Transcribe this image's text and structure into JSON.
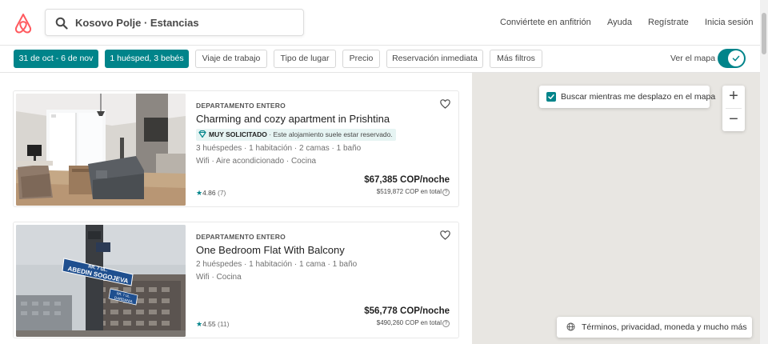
{
  "header": {
    "search_text": "Kosovo Polje · Estancias",
    "nav": {
      "host": "Conviértete en anfitrión",
      "help": "Ayuda",
      "signup": "Regístrate",
      "login": "Inicia sesión"
    }
  },
  "filters": {
    "dates": "31 de oct - 6 de nov",
    "guests": "1 huésped, 3 bebés",
    "work_trip": "Viaje de trabajo",
    "place_type": "Tipo de lugar",
    "price": "Precio",
    "instant_book": "Reservación inmediata",
    "more_filters": "Más filtros",
    "show_map": "Ver el mapa",
    "show_map_on": true
  },
  "listings": [
    {
      "type": "DEPARTAMENTO ENTERO",
      "title": "Charming and cozy apartment in Prishtina",
      "badge_label": "MUY SOLICITADO",
      "badge_text": " · Este alojamiento suele estar reservado.",
      "details": "3 huéspedes · 1 habitación · 2 camas · 1 baño",
      "amenities": "Wifi · Aire acondicionado · Cocina",
      "rating": "4.86",
      "reviews": "(7)",
      "price": "$67,385 COP/noche",
      "total": "$519,872 COP en total",
      "help_glyph": "?"
    },
    {
      "type": "DEPARTAMENTO ENTERO",
      "title": "One Bedroom Flat With Balcony",
      "details": "2 huéspedes · 1 habitación · 1 cama · 1 baño",
      "amenities": "Wifi · Cocina",
      "rating": "4.55",
      "reviews": "(11)",
      "price": "$56,778 COP/noche",
      "total": "$490,260 COP en total",
      "help_glyph": "?",
      "photo_sign_top": "RR. 7 UL.",
      "photo_sign_main": "ABEDIN SOGOJEVA",
      "photo_sign_small_1": "RR. 7 UL.",
      "photo_sign_small_2": "DARDANIA"
    }
  ],
  "map": {
    "search_as_move": "Buscar mientras me desplazo en el mapa",
    "search_as_move_checked": true,
    "zoom_in": "+",
    "zoom_out": "−",
    "footer": "Términos, privacidad, moneda y mucho más"
  },
  "colors": {
    "accent": "#00848a",
    "brand": "#ff5a5f",
    "map_bg": "#e8e6e2"
  },
  "icons": {
    "logo": "airbnb-logo-icon",
    "search": "search-icon",
    "heart": "heart-icon",
    "check": "check-icon",
    "globe": "globe-icon",
    "star": "star-icon",
    "diamond": "diamond-icon"
  }
}
